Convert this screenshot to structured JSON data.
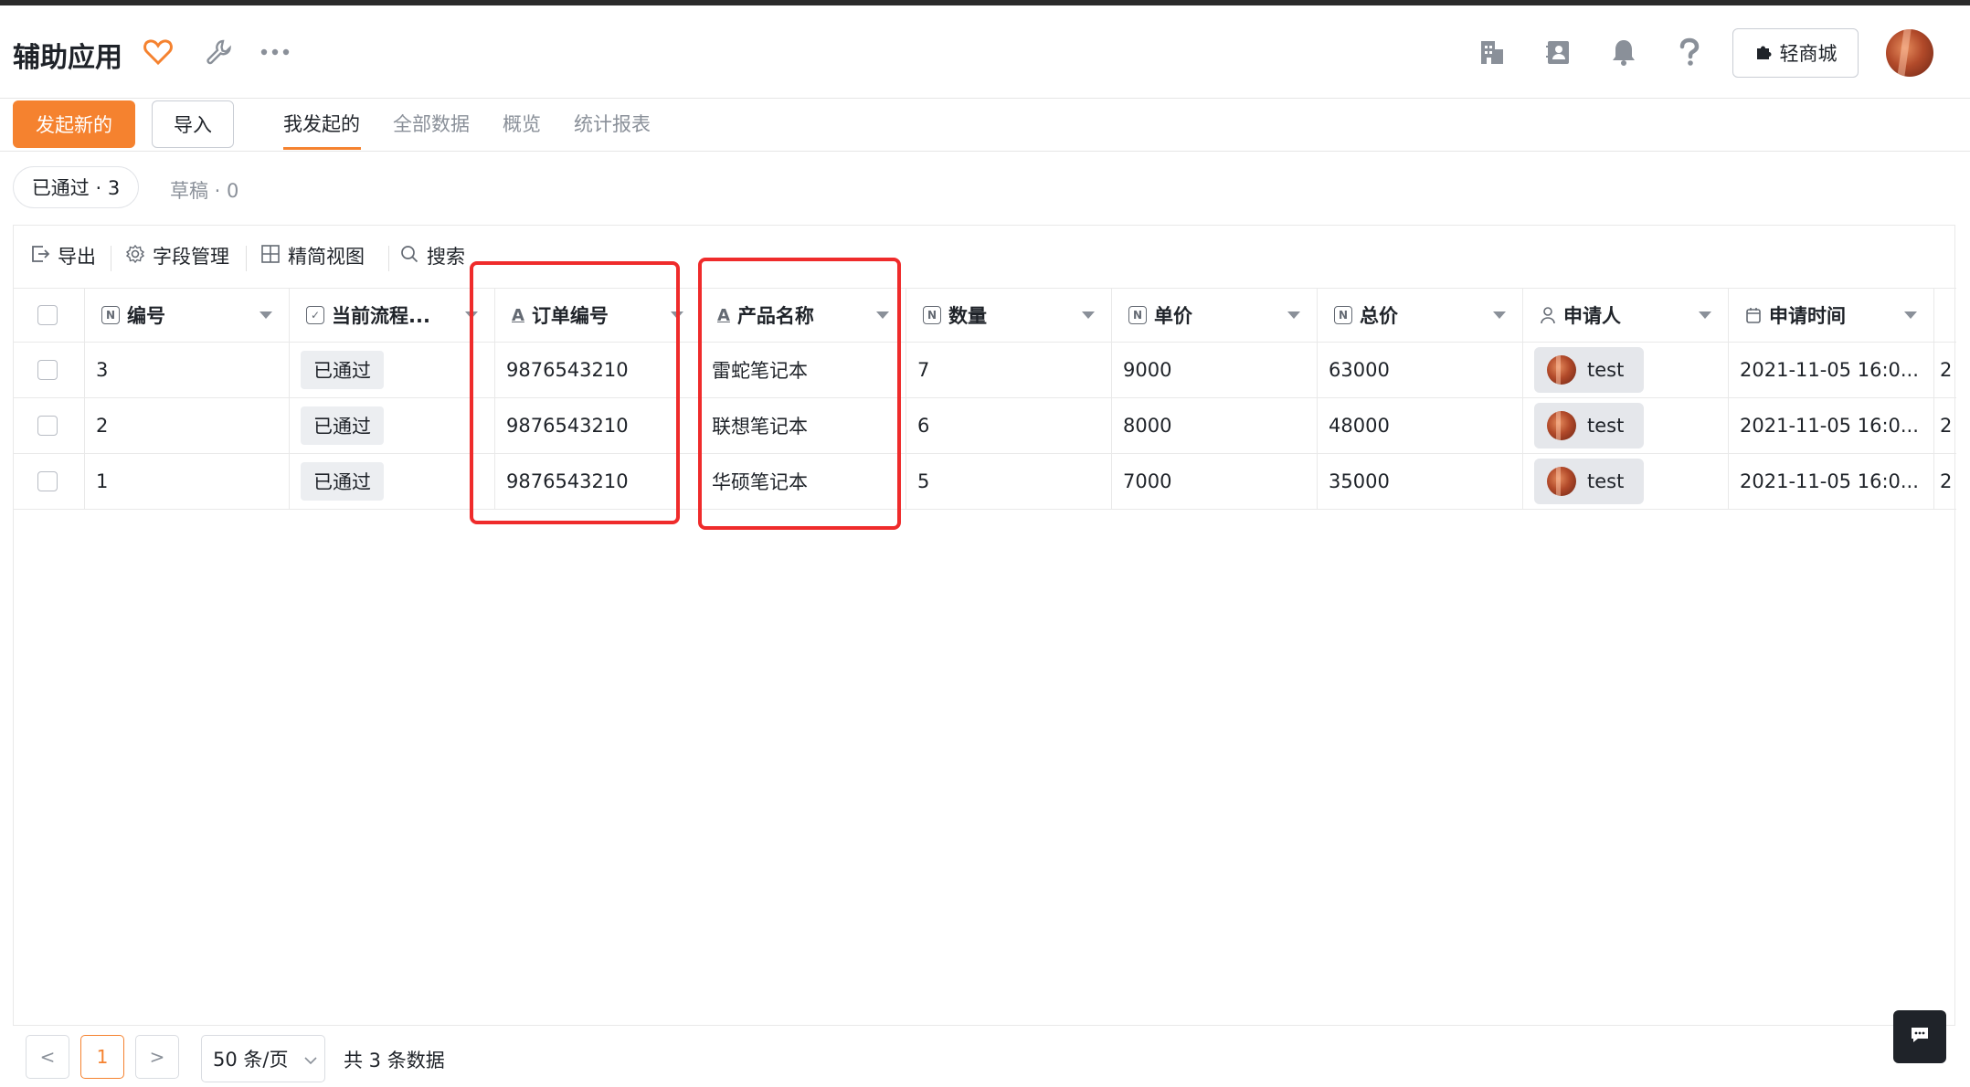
{
  "app": {
    "title": "辅助应用"
  },
  "header_icons": [
    "heart-icon",
    "wrench-icon",
    "more-icon",
    "building-icon",
    "contacts-icon",
    "bell-icon",
    "help-icon"
  ],
  "mall_button": {
    "label": "轻商城"
  },
  "actions": {
    "create": "发起新的",
    "import": "导入"
  },
  "tabs": [
    {
      "label": "我发起的",
      "active": true
    },
    {
      "label": "全部数据",
      "active": false
    },
    {
      "label": "概览",
      "active": false
    },
    {
      "label": "统计报表",
      "active": false
    }
  ],
  "filters": {
    "approved": "已通过 · 3",
    "draft": "草稿 · 0"
  },
  "toolbar": {
    "export": "导出",
    "fields": "字段管理",
    "compact": "精简视图",
    "search": "搜索"
  },
  "columns": [
    {
      "key": "id",
      "label": "编号",
      "icon": "N"
    },
    {
      "key": "flow",
      "label": "当前流程...",
      "icon": "check"
    },
    {
      "key": "order_no",
      "label": "订单编号",
      "icon": "A"
    },
    {
      "key": "product",
      "label": "产品名称",
      "icon": "A"
    },
    {
      "key": "qty",
      "label": "数量",
      "icon": "N"
    },
    {
      "key": "price",
      "label": "单价",
      "icon": "N"
    },
    {
      "key": "total",
      "label": "总价",
      "icon": "N"
    },
    {
      "key": "applicant",
      "label": "申请人",
      "icon": "user"
    },
    {
      "key": "time",
      "label": "申请时间",
      "icon": "calendar"
    }
  ],
  "rows": [
    {
      "id": "3",
      "flow": "已通过",
      "order_no": "9876543210",
      "product": "雷蛇笔记本",
      "qty": "7",
      "price": "9000",
      "total": "63000",
      "applicant": "test",
      "time": "2021-11-05 16:0...",
      "overflow": "2"
    },
    {
      "id": "2",
      "flow": "已通过",
      "order_no": "9876543210",
      "product": "联想笔记本",
      "qty": "6",
      "price": "8000",
      "total": "48000",
      "applicant": "test",
      "time": "2021-11-05 16:0...",
      "overflow": "2"
    },
    {
      "id": "1",
      "flow": "已通过",
      "order_no": "9876543210",
      "product": "华硕笔记本",
      "qty": "5",
      "price": "7000",
      "total": "35000",
      "applicant": "test",
      "time": "2021-11-05 16:0...",
      "overflow": "2"
    }
  ],
  "pagination": {
    "prev": "<",
    "current": "1",
    "next": ">",
    "page_size": "50 条/页",
    "total": "共 3 条数据"
  },
  "colors": {
    "accent": "#f5822f",
    "highlight": "#ef2b2b"
  }
}
